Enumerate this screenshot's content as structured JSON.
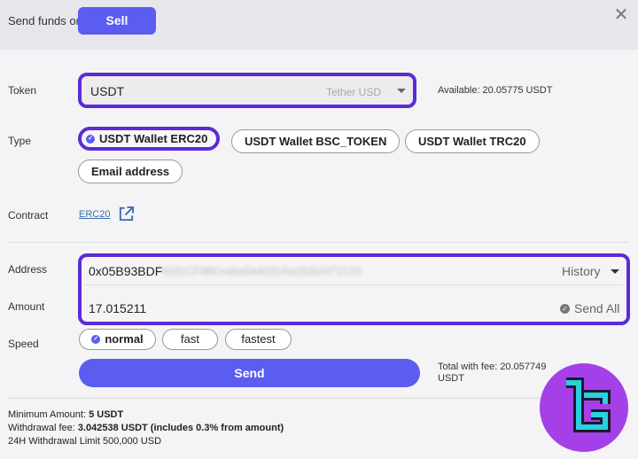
{
  "header": {
    "lead_text": "Send funds or",
    "sell_label": "Sell",
    "close_glyph": "✕"
  },
  "token": {
    "label": "Token",
    "value": "USDT",
    "subtitle": "Tether USD",
    "available": "Available: 20.05775 USDT"
  },
  "type": {
    "label": "Type",
    "options": [
      "USDT Wallet ERC20",
      "USDT Wallet BSC_TOKEN",
      "USDT Wallet TRC20",
      "Email address"
    ],
    "selected": "USDT Wallet ERC20"
  },
  "contract": {
    "label": "Contract",
    "link_text": "ERC20"
  },
  "address": {
    "label": "Address",
    "value": "0x05B93BDF",
    "obscured": "8181CF9BCeabaDe8331Aa182b2471C20",
    "history_label": "History"
  },
  "amount": {
    "label": "Amount",
    "value": "17.015211",
    "send_all_label": "Send All"
  },
  "speed": {
    "label": "Speed",
    "options": [
      "normal",
      "fast",
      "fastest"
    ],
    "selected": "normal"
  },
  "send": {
    "label": "Send",
    "total_with_fee": "Total with fee: 20.057749 USDT"
  },
  "info": {
    "min_label": "Minimum Amount: ",
    "min_value": "5 USDT",
    "fee_label": "Withdrawal fee: ",
    "fee_value": "3.042538 USDT (includes 0.3% from amount)",
    "limit_text": "24H Withdrawal Limit 500,000 USD"
  },
  "icons": {
    "external_link": "external-link-icon",
    "checkmark": "check-icon",
    "brand_logo": "brand-logo"
  },
  "colors": {
    "accent": "#5b5cf0",
    "highlight": "#5c2bd6",
    "logo": "#a540e8",
    "logo_mark": "#29d0e0"
  }
}
